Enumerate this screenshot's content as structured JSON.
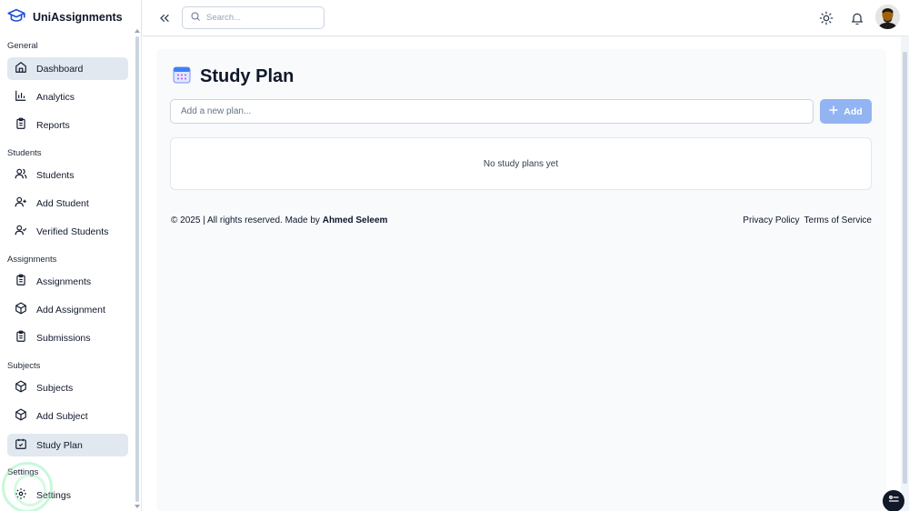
{
  "app": {
    "name": "UniAssignments"
  },
  "sidebar": {
    "sections": [
      {
        "label": "General",
        "items": [
          {
            "label": "Dashboard",
            "icon": "home-icon",
            "active": true
          },
          {
            "label": "Analytics",
            "icon": "bar-chart-icon"
          },
          {
            "label": "Reports",
            "icon": "clipboard-icon"
          }
        ]
      },
      {
        "label": "Students",
        "items": [
          {
            "label": "Students",
            "icon": "users-icon"
          },
          {
            "label": "Add Student",
            "icon": "user-plus-icon"
          },
          {
            "label": "Verified Students",
            "icon": "user-check-icon"
          }
        ]
      },
      {
        "label": "Assignments",
        "items": [
          {
            "label": "Assignments",
            "icon": "clipboard-list-icon"
          },
          {
            "label": "Add Assignment",
            "icon": "package-plus-icon"
          },
          {
            "label": "Submissions",
            "icon": "clipboard-check-icon"
          }
        ]
      },
      {
        "label": "Subjects",
        "items": [
          {
            "label": "Subjects",
            "icon": "box-icon"
          },
          {
            "label": "Add Subject",
            "icon": "package-plus-icon"
          },
          {
            "label": "Study Plan",
            "icon": "calendar-check-icon",
            "active": true
          }
        ]
      },
      {
        "label": "Settings",
        "items": [
          {
            "label": "Settings",
            "icon": "gear-icon"
          }
        ]
      }
    ]
  },
  "topbar": {
    "search_placeholder": "Search..."
  },
  "page": {
    "title": "Study Plan",
    "input_placeholder": "Add a new plan...",
    "add_label": "Add",
    "empty_text": "No study plans yet"
  },
  "footer": {
    "copyright": "© 2025 | All rights reserved. Made by ",
    "author": "Ahmed Seleem",
    "privacy": "Privacy Policy",
    "terms": "Terms of Service"
  },
  "colors": {
    "brand": "#1d4ed8",
    "add_button": "#93b4f2",
    "active_item": "#e2e8f0"
  }
}
